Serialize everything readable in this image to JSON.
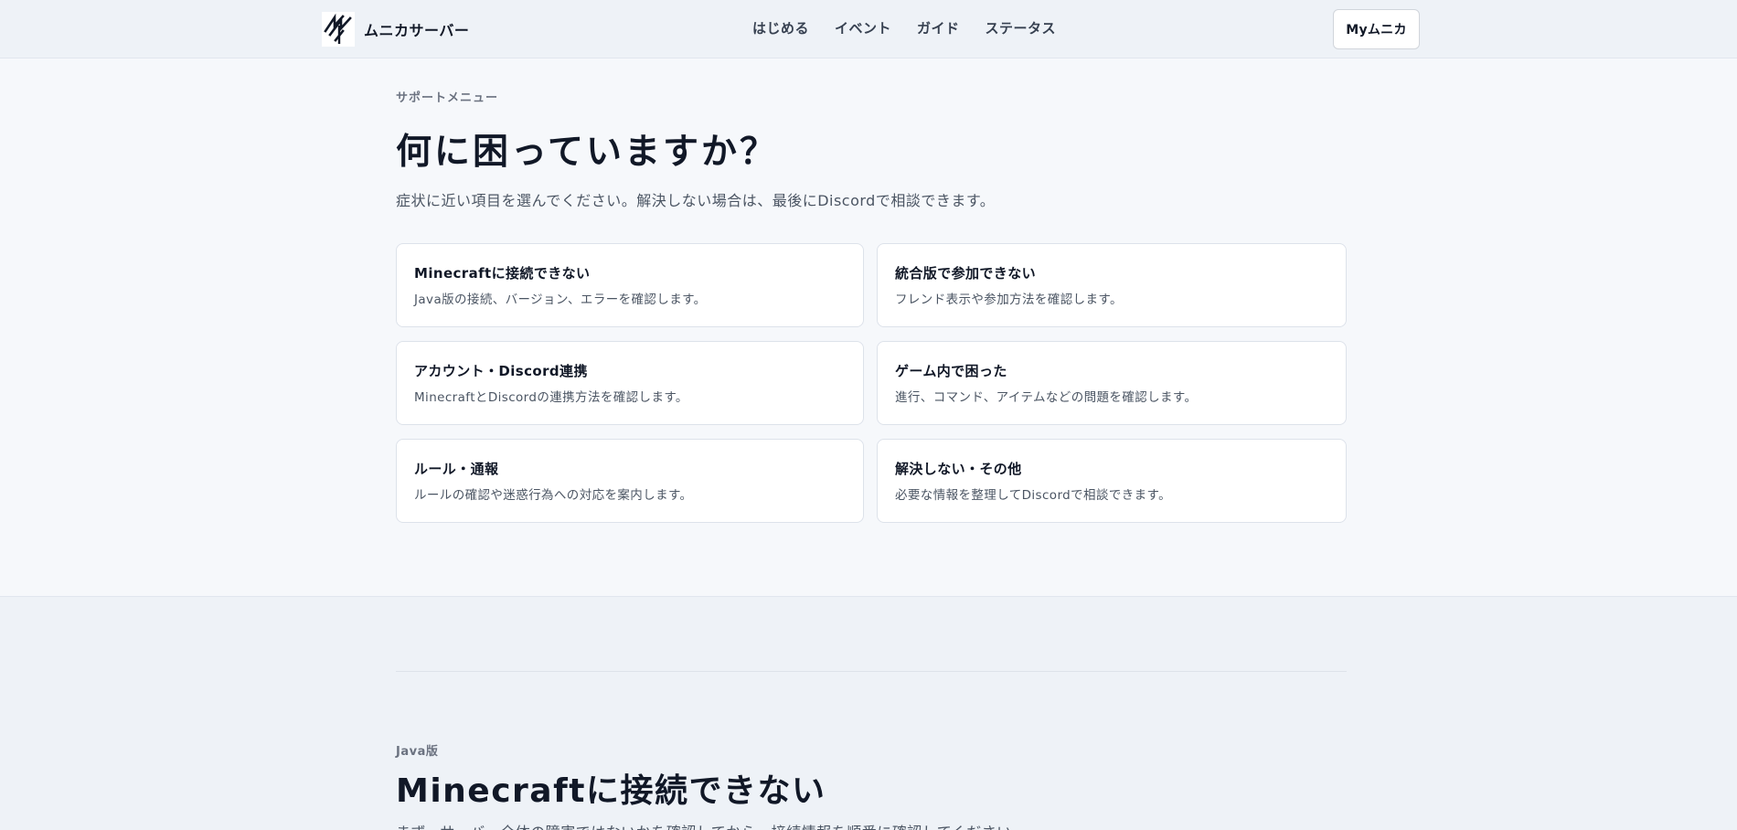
{
  "header": {
    "brand_name": "ムニカサーバー",
    "logo_icon": "munika-logo-icon",
    "nav": [
      {
        "label": "はじめる"
      },
      {
        "label": "イベント"
      },
      {
        "label": "ガイド"
      },
      {
        "label": "ステータス"
      }
    ],
    "my_button_label": "Myムニカ"
  },
  "hero": {
    "section_label": "サポートメニュー",
    "title": "何に困っていますか？",
    "subtitle": "症状に近い項目を選んでください。解決しない場合は、最後にDiscordで相談できます。",
    "cards": [
      {
        "title": "Minecraftに接続できない",
        "description": "Java版の接続、バージョン、エラーを確認します。"
      },
      {
        "title": "統合版で参加できない",
        "description": "フレンド表示や参加方法を確認します。"
      },
      {
        "title": "アカウント・Discord連携",
        "description": "MinecraftとDiscordの連携方法を確認します。"
      },
      {
        "title": "ゲーム内で困った",
        "description": "進行、コマンド、アイテムなどの問題を確認します。"
      },
      {
        "title": "ルール・通報",
        "description": "ルールの確認や迷惑行為への対応を案内します。"
      },
      {
        "title": "解決しない・その他",
        "description": "必要な情報を整理してDiscordで相談できます。"
      }
    ]
  },
  "java_section": {
    "label": "Java版",
    "title": "Minecraftに接続できない",
    "intro": "まず、サーバー全体の障害ではないかを確認してから、接続情報を順番に確認してください。"
  },
  "colors": {
    "page_bg": "#f6f8fb",
    "header_bg": "#eef2f7",
    "card_bg": "#ffffff",
    "text_primary": "#111827",
    "text_secondary": "#4b5563"
  }
}
